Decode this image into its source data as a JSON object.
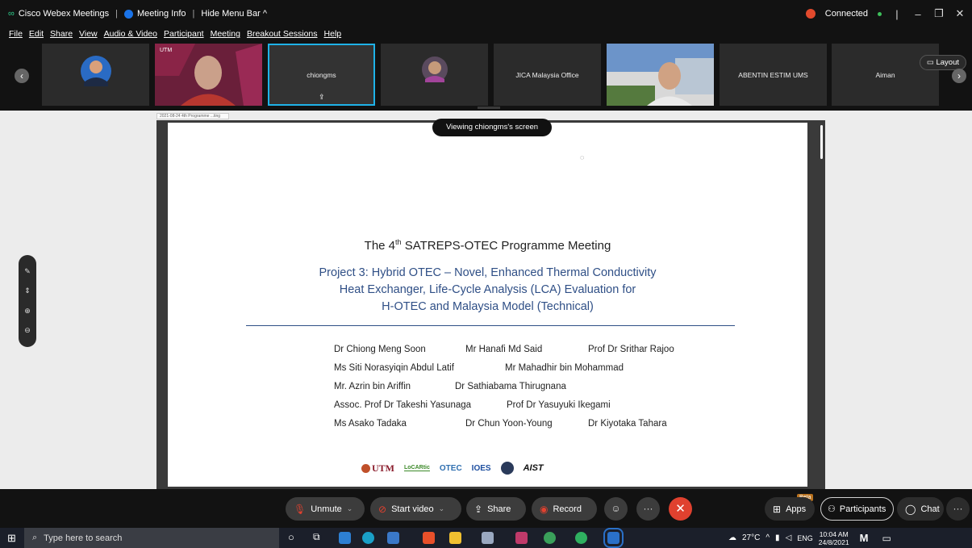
{
  "titlebar": {
    "app_name": "Cisco Webex Meetings",
    "meeting_info": "Meeting Info",
    "hide_menu": "Hide Menu Bar ^",
    "connected": "Connected"
  },
  "menu": [
    "File",
    "Edit",
    "Share",
    "View",
    "Audio & Video",
    "Participant",
    "Meeting",
    "Breakout Sessions",
    "Help"
  ],
  "participants": [
    {
      "label": "",
      "kind": "avatar"
    },
    {
      "label": "",
      "kind": "video-utm"
    },
    {
      "label": "chiongms",
      "kind": "sharing",
      "active": true
    },
    {
      "label": "",
      "kind": "avatar-female"
    },
    {
      "label": "JICA Malaysia Office",
      "kind": "name"
    },
    {
      "label": "",
      "kind": "video-building"
    },
    {
      "label": "ABENTIN ESTIM UMS",
      "kind": "name"
    },
    {
      "label": "Aiman",
      "kind": "name"
    }
  ],
  "layout_label": "Layout",
  "share": {
    "tab_label": "2021-08-24 4th Programme ...ting",
    "viewing_label": "Viewing chiongms's screen"
  },
  "slide": {
    "title_pre": "The 4",
    "title_sup": "th",
    "title_post": " SATREPS-OTEC Programme Meeting",
    "subtitle_lines": [
      "Project 3: Hybrid OTEC – Novel, Enhanced Thermal Conductivity",
      "Heat Exchanger, Life-Cycle Analysis (LCA) Evaluation for",
      "H-OTEC and Malaysia Model (Technical)"
    ],
    "authors": [
      [
        "Dr Chiong Meng Soon",
        "Mr Hanafi Md Said",
        "Prof Dr Srithar Rajoo"
      ],
      [
        "Ms Siti Norasyiqin Abdul Latif",
        "Mr Mahadhir bin Mohammad"
      ],
      [
        "Mr. Azrin bin Ariffin",
        "Dr Sathiabama Thirugnana"
      ],
      [
        "Assoc. Prof Dr Takeshi Yasunaga",
        "Prof Dr Yasuyuki Ikegami"
      ],
      [
        "Ms Asako Tadaka",
        "Dr Chun Yoon-Young",
        "Dr Kiyotaka Tahara"
      ]
    ],
    "logos": [
      "UTM",
      "LoCARtic",
      "OTEC",
      "IOES",
      "AIST"
    ]
  },
  "controls": {
    "unmute": "Unmute",
    "start_video": "Start video",
    "share": "Share",
    "record": "Record",
    "apps": "Apps",
    "beta": "Beta",
    "participants": "Participants",
    "chat": "Chat"
  },
  "taskbar": {
    "search_placeholder": "Type here to search",
    "temperature": "27°C",
    "lang": "ENG",
    "time": "10:04 AM",
    "date": "24/8/2021"
  },
  "colors": {
    "accent_active": "#1fb2e8",
    "end_button": "#e0412f",
    "slide_blue": "#2f4f86"
  }
}
